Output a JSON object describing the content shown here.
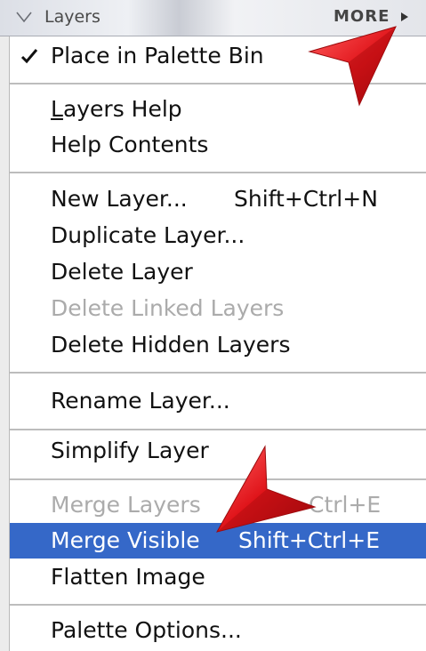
{
  "header": {
    "title": "Layers",
    "more_label": "MORE"
  },
  "menu": {
    "place_in_palette_bin": {
      "label": "Place in Palette Bin",
      "checked": true
    },
    "layers_help": {
      "underlined_char": "L",
      "rest": "ayers Help"
    },
    "help_contents": {
      "label": "Help Contents"
    },
    "new_layer": {
      "label": "New Layer...",
      "shortcut": "Shift+Ctrl+N"
    },
    "duplicate_layer": {
      "label": "Duplicate Layer..."
    },
    "delete_layer": {
      "label": "Delete Layer"
    },
    "delete_linked_layers": {
      "label": "Delete Linked Layers",
      "disabled": true
    },
    "delete_hidden_layers": {
      "label": "Delete Hidden Layers"
    },
    "rename_layer": {
      "label": "Rename Layer..."
    },
    "simplify_layer": {
      "label": "Simplify Layer"
    },
    "merge_layers": {
      "label": "Merge Layers",
      "shortcut": "Ctrl+E",
      "disabled": true
    },
    "merge_visible": {
      "label": "Merge Visible",
      "shortcut": "Shift+Ctrl+E",
      "highlighted": true
    },
    "flatten_image": {
      "label": "Flatten Image"
    },
    "palette_options": {
      "label": "Palette Options..."
    }
  },
  "colors": {
    "highlight": "#3568c8",
    "disabled_text": "#ababab",
    "annotation_arrow": "#e0141a"
  },
  "icons": {
    "collapse": "chevron-down-icon",
    "more_arrow": "triangle-right-icon",
    "check": "checkmark-icon",
    "annotation": "red-arrow-icon"
  }
}
